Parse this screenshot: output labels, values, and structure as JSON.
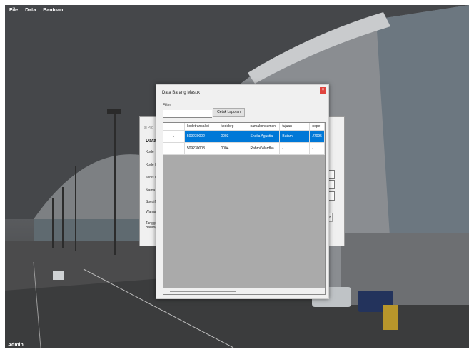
{
  "menu": {
    "items": [
      "File",
      "Data",
      "Bantuan"
    ]
  },
  "status_bar": {
    "user": "Admin"
  },
  "background_form": {
    "title_partial": "si Pro",
    "header_partial": "Data",
    "labels": [
      "Kode",
      "Kode I",
      "Jenis I",
      "Nama",
      "Spesifi",
      "Warna",
      "Tangg",
      "Barang"
    ],
    "button_partial": "r"
  },
  "dialog": {
    "title": "Data Barang Masuk",
    "close_glyph": "×",
    "filter_label": "Filter",
    "filter_value": "",
    "print_button": "Cetak Laporan",
    "grid": {
      "columns": [
        "kodetransaksi",
        "kodebrg",
        "namakonsumen",
        "tujuan",
        "nope"
      ],
      "rows": [
        {
          "selected": true,
          "indicator": "▸",
          "cells": [
            "509230002",
            "0003",
            "Sheila Agustia",
            "Batam",
            "J7095"
          ]
        },
        {
          "selected": false,
          "indicator": "",
          "cells": [
            "509230003",
            "0004",
            "Rahmi Wardha",
            "-",
            "-"
          ]
        }
      ]
    }
  }
}
